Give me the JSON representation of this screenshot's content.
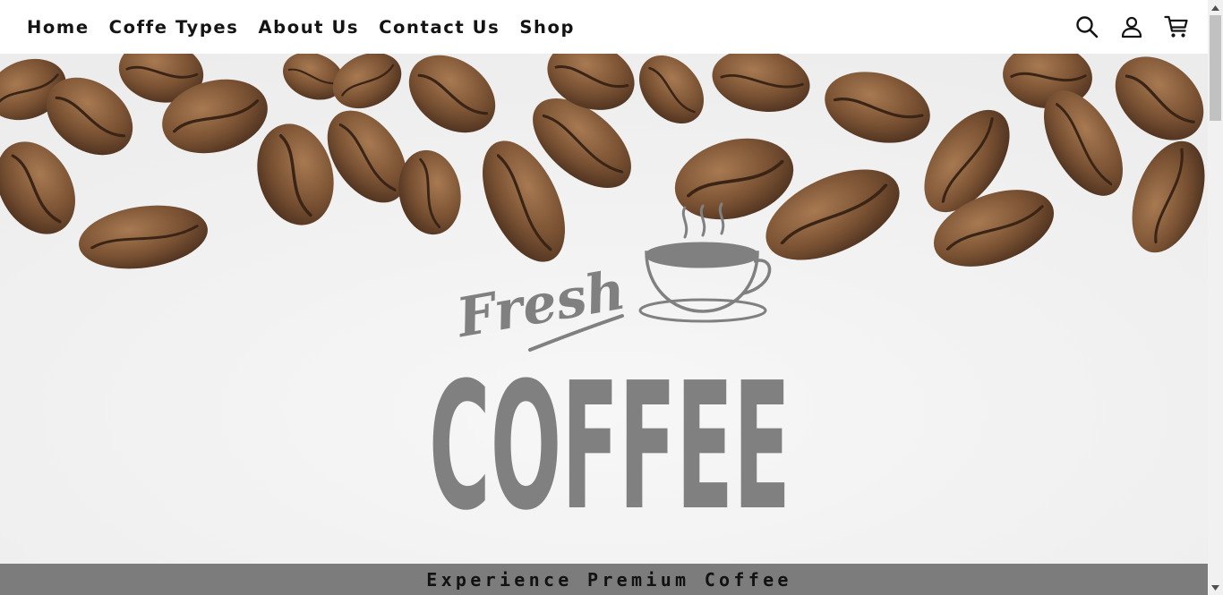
{
  "nav": {
    "links": [
      {
        "label": "Home"
      },
      {
        "label": "Coffe Types"
      },
      {
        "label": "About Us"
      },
      {
        "label": "Contact Us"
      },
      {
        "label": "Shop"
      }
    ],
    "icons": [
      "search-icon",
      "user-icon",
      "cart-icon"
    ]
  },
  "hero": {
    "logo_script": "Fresh",
    "logo_word": "COFFEE"
  },
  "banner": {
    "text": "Experience Premium Coffee"
  },
  "colors": {
    "nav_text": "#141414",
    "logo_gray": "#808080",
    "banner_bg": "#7c7c7c",
    "bean_brown": "#7a5233"
  }
}
